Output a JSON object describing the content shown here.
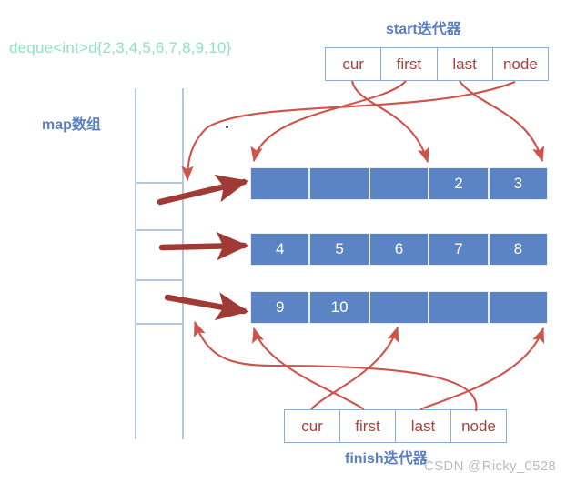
{
  "diagram": {
    "declaration": "deque<int>d{2,3,4,5,6,7,8,9,10}",
    "map_label": "map数组",
    "start_title": "start迭代器",
    "finish_title": "finish迭代器",
    "watermark": "CSDN @Ricky_0528"
  },
  "colors": {
    "buffer_fill": "#5b84c4",
    "box_border": "#8badd4",
    "field_text": "#a8413c",
    "title_blue": "#5b7fbf",
    "declaration_green": "#8ee3bf",
    "thin_arrow": "#cf5349",
    "thick_arrow": "#a03a35",
    "map_line": "#b6c6dc",
    "watermark_gray": "#b9bcc4"
  },
  "start_iterator": {
    "title": "start迭代器",
    "fields": [
      {
        "label": "cur"
      },
      {
        "label": "first"
      },
      {
        "label": "last"
      },
      {
        "label": "node"
      }
    ]
  },
  "finish_iterator": {
    "title": "finish迭代器",
    "fields": [
      {
        "label": "cur"
      },
      {
        "label": "first"
      },
      {
        "label": "last"
      },
      {
        "label": "node"
      }
    ]
  },
  "map_array": {
    "label": "map数组",
    "divider_count": 4
  },
  "buffers": [
    {
      "slots": [
        "",
        "",
        "",
        "2",
        "3"
      ]
    },
    {
      "slots": [
        "4",
        "5",
        "6",
        "7",
        "8"
      ]
    },
    {
      "slots": [
        "9",
        "10",
        "",
        "",
        ""
      ]
    }
  ]
}
